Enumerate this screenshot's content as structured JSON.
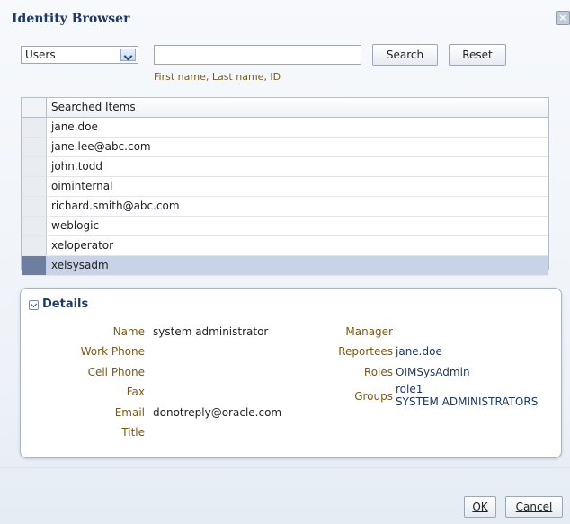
{
  "dialog": {
    "title": "Identity Browser",
    "close_icon": "close-icon"
  },
  "search": {
    "type_selected": "Users",
    "query_value": "",
    "hint": "First name, Last name, ID",
    "search_label": "Search",
    "reset_label": "Reset"
  },
  "results": {
    "header": "Searched Items",
    "rows": [
      "jane.doe",
      "jane.lee@abc.com",
      "john.todd",
      "oiminternal",
      "richard.smith@abc.com",
      "weblogic",
      "xeloperator",
      "xelsysadm"
    ],
    "selected_index": 7
  },
  "details": {
    "title": "Details",
    "labels": {
      "name": "Name",
      "work_phone": "Work Phone",
      "cell_phone": "Cell Phone",
      "fax": "Fax",
      "email": "Email",
      "title": "Title",
      "manager": "Manager",
      "reportees": "Reportees",
      "roles": "Roles",
      "groups": "Groups"
    },
    "values": {
      "name": "system administrator",
      "work_phone": "",
      "cell_phone": "",
      "fax": "",
      "email": "donotreply@oracle.com",
      "title": "",
      "manager": "",
      "reportees": "jane.doe",
      "roles": "OIMSysAdmin",
      "groups": [
        "role1",
        "SYSTEM ADMINISTRATORS"
      ]
    }
  },
  "footer": {
    "ok_label": "OK",
    "cancel_label": "Cancel"
  }
}
